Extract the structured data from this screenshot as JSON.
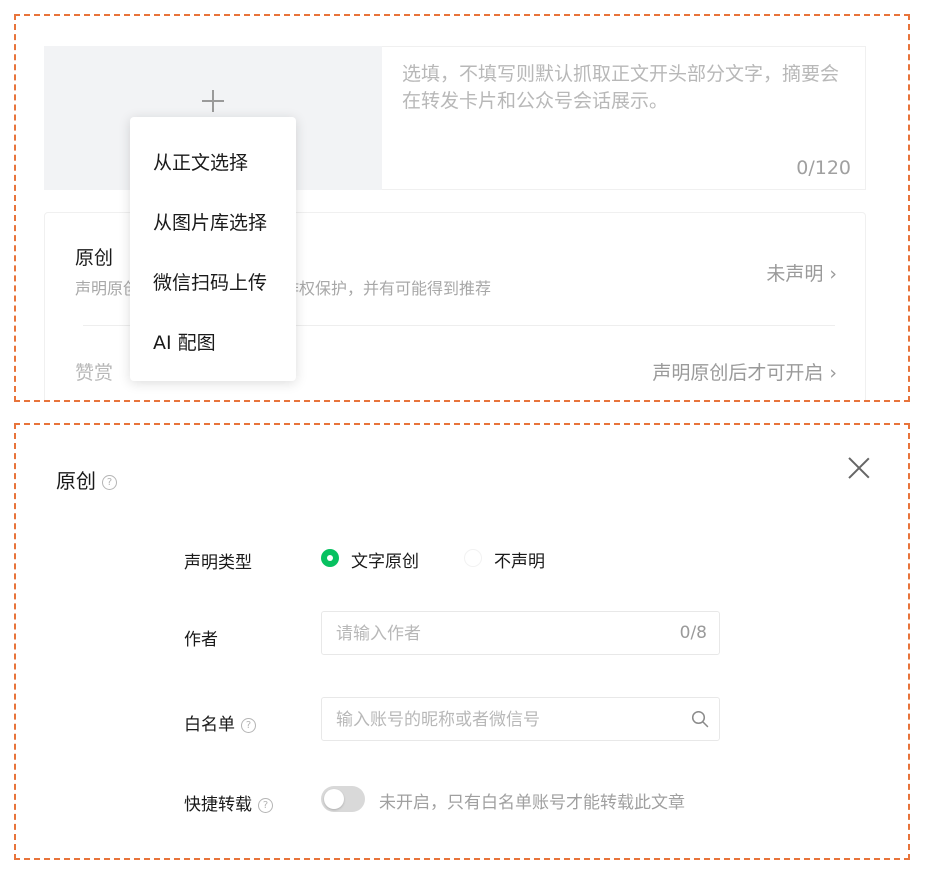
{
  "cover": {
    "plus_icon": "plus-icon",
    "menu": {
      "items": [
        "从正文选择",
        "从图片库选择",
        "微信扫码上传",
        "AI 配图"
      ]
    }
  },
  "summary": {
    "placeholder": "选填，不填写则默认抓取正文开头部分文字，摘要会在转发卡片和公众号会话展示。",
    "count": "0/120"
  },
  "settings": {
    "original": {
      "title": "原创",
      "desc_left": "声明原创",
      "desc_right": "作权保护，并有可能得到推荐",
      "status": "未声明 ›"
    },
    "reward": {
      "title": "赞赏",
      "status": "声明原创后才可开启 ›"
    }
  },
  "dialog": {
    "title": "原创",
    "help_glyph": "?",
    "declare_type": {
      "label": "声明类型",
      "options": [
        "文字原创",
        "不声明"
      ],
      "selected": "文字原创"
    },
    "author": {
      "label": "作者",
      "placeholder": "请输入作者",
      "count": "0/8"
    },
    "whitelist": {
      "label": "白名单",
      "placeholder": "输入账号的昵称或者微信号"
    },
    "quick_repost": {
      "label": "快捷转载",
      "enabled": false,
      "text": "未开启，只有白名单账号才能转载此文章"
    }
  },
  "colors": {
    "accent": "#07c160",
    "dashed_border": "#e8743b"
  }
}
